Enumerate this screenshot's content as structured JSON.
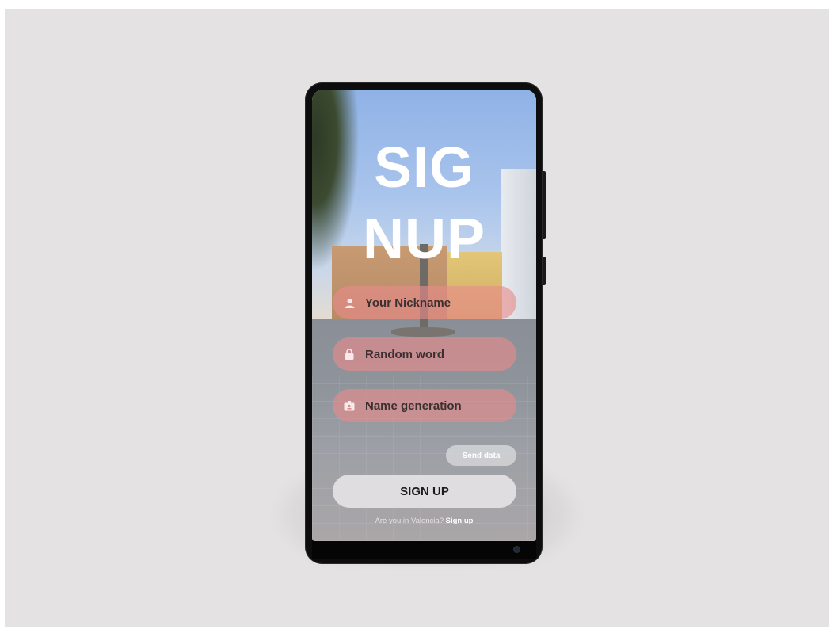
{
  "screen": {
    "title_line1": "SIG",
    "title_line2": "NUP",
    "fields": [
      {
        "icon": "user-icon",
        "placeholder": "Your Nickname"
      },
      {
        "icon": "lock-icon",
        "placeholder": "Random word"
      },
      {
        "icon": "badge-icon",
        "placeholder": "Name generation"
      }
    ],
    "send_label": "Send data",
    "signup_label": "SIGN UP",
    "footer_question": "Are you in Valencia?",
    "footer_link": "Sign up"
  },
  "colors": {
    "backdrop": "#e4e2e3",
    "field_fill": "#e88a8a",
    "title_text": "#ffffff",
    "button_fill": "#e4e2e4"
  }
}
